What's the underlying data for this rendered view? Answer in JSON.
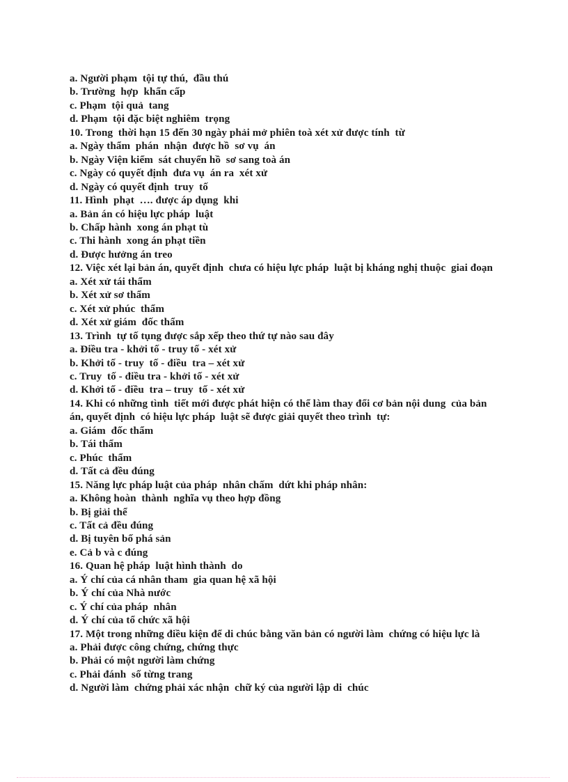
{
  "document": {
    "language": "vi",
    "page_background": "#ffffff",
    "text_color": "#1a1a1a",
    "footer_rule_color": "#f4a9cd",
    "lines": [
      {
        "id": "q9-opt-a",
        "kind": "option",
        "text": "a. Người phạm  tội tự thú,  đầu thú"
      },
      {
        "id": "q9-opt-b",
        "kind": "option",
        "text": "b. Trường  hợp  khẩn cấp"
      },
      {
        "id": "q9-opt-c",
        "kind": "option",
        "text": "c. Phạm  tội quả  tang"
      },
      {
        "id": "q9-opt-d",
        "kind": "option",
        "text": "d. Phạm  tội đặc biệt nghiêm  trọng"
      },
      {
        "id": "q10-stem",
        "kind": "question",
        "text": "10. Trong  thời hạn 15 đến 30 ngày phải mở phiên toà xét xử được tính  từ"
      },
      {
        "id": "q10-opt-a",
        "kind": "option",
        "text": "a. Ngày thẩm  phán  nhận  được hồ  sơ vụ  án"
      },
      {
        "id": "q10-opt-b",
        "kind": "option",
        "text": "b. Ngày Viện kiểm  sát chuyển hồ  sơ sang toà án"
      },
      {
        "id": "q10-opt-c",
        "kind": "option",
        "text": "c. Ngày có quyết định  đưa vụ  án ra  xét xử"
      },
      {
        "id": "q10-opt-d",
        "kind": "option",
        "text": "d. Ngày có quyết định  truy  tố"
      },
      {
        "id": "q11-stem",
        "kind": "question",
        "text": "11. Hình  phạt  …. được áp dụng  khi"
      },
      {
        "id": "q11-opt-a",
        "kind": "option",
        "text": "a. Bản án có hiệu lực pháp  luật"
      },
      {
        "id": "q11-opt-b",
        "kind": "option",
        "text": "b. Chấp hành  xong án phạt tù"
      },
      {
        "id": "q11-opt-c",
        "kind": "option",
        "text": "c. Thi hành  xong án phạt tiền"
      },
      {
        "id": "q11-opt-d",
        "kind": "option",
        "text": "d. Được hưởng án treo"
      },
      {
        "id": "q12-stem",
        "kind": "question",
        "text": "12. Việc xét lại bản án, quyết định  chưa có hiệu lực pháp  luật bị kháng nghị thuộc  giai đoạn"
      },
      {
        "id": "q12-opt-a",
        "kind": "option",
        "text": "a. Xét xử tái thẩm"
      },
      {
        "id": "q12-opt-b",
        "kind": "option",
        "text": "b. Xét xử sơ thẩm"
      },
      {
        "id": "q12-opt-c",
        "kind": "option",
        "text": "c. Xét xử phúc  thẩm"
      },
      {
        "id": "q12-opt-d",
        "kind": "option",
        "text": "d. Xét xử giám  đốc thẩm"
      },
      {
        "id": "q13-stem",
        "kind": "question",
        "text": "13. Trình  tự tố tụng được sắp xếp theo thứ tự nào sau đây"
      },
      {
        "id": "q13-opt-a",
        "kind": "option",
        "text": "a. Điều tra - khởi tố - truy tố - xét xử"
      },
      {
        "id": "q13-opt-b",
        "kind": "option",
        "text": "b. Khởi tố - truy  tố - điều  tra – xét xử"
      },
      {
        "id": "q13-opt-c",
        "kind": "option",
        "text": "c. Truy  tố - điều tra - khởi tố - xét xử"
      },
      {
        "id": "q13-opt-d",
        "kind": "option",
        "text": "d. Khởi tố - điều  tra – truy  tố - xét xử"
      },
      {
        "id": "q14-stem",
        "kind": "question",
        "text": "14. Khi có những tình  tiết mới được phát hiện có thể làm thay đổi cơ bản nội dung  của bản"
      },
      {
        "id": "q14-stem2",
        "kind": "cont",
        "text": "án, quyết định  có hiệu lực pháp  luật sẽ được giải quyết theo trình  tự:"
      },
      {
        "id": "q14-opt-a",
        "kind": "option",
        "text": "a. Giám  đốc thẩm"
      },
      {
        "id": "q14-opt-b",
        "kind": "option",
        "text": "b. Tái thẩm"
      },
      {
        "id": "q14-opt-c",
        "kind": "option",
        "text": "c. Phúc  thẩm"
      },
      {
        "id": "q14-opt-d",
        "kind": "option",
        "text": "d. Tất cả đều đúng"
      },
      {
        "id": "q15-stem",
        "kind": "question",
        "text": "15. Năng lực pháp luật của pháp  nhân chấm  dứt khi pháp nhân:"
      },
      {
        "id": "q15-opt-a",
        "kind": "option",
        "text": "a. Không hoàn  thành  nghĩa vụ theo hợp đồng"
      },
      {
        "id": "q15-opt-b",
        "kind": "option",
        "text": "b. Bị giải thể"
      },
      {
        "id": "q15-opt-c",
        "kind": "option",
        "text": "c. Tất cả đều đúng"
      },
      {
        "id": "q15-opt-d",
        "kind": "option",
        "text": "d. Bị tuyên bố phá sản"
      },
      {
        "id": "q15-opt-e",
        "kind": "option",
        "text": "e. Cả b và c đúng"
      },
      {
        "id": "q16-stem",
        "kind": "question",
        "text": "16. Quan hệ pháp  luật hình thành  do"
      },
      {
        "id": "q16-opt-a",
        "kind": "option",
        "text": "a. Ý chí của cá nhân tham  gia quan hệ xã hội"
      },
      {
        "id": "q16-opt-b",
        "kind": "option",
        "text": "b. Ý chí của Nhà nước"
      },
      {
        "id": "q16-opt-c",
        "kind": "option",
        "text": "c. Ý chí của pháp  nhân"
      },
      {
        "id": "q16-opt-d",
        "kind": "option",
        "text": "d. Ý chí của tổ chức xã hội"
      },
      {
        "id": "q17-stem",
        "kind": "question",
        "text": "17. Một trong những điều kiện để di chúc bằng văn bản có người làm  chứng có hiệu lực là"
      },
      {
        "id": "q17-opt-a",
        "kind": "option",
        "text": "a. Phải được công chứng, chứng thực"
      },
      {
        "id": "q17-opt-b",
        "kind": "option",
        "text": "b. Phải có một người làm chứng"
      },
      {
        "id": "q17-opt-c",
        "kind": "option",
        "text": "c. Phải đánh  số từng trang"
      },
      {
        "id": "q17-opt-d",
        "kind": "option",
        "text": "d. Người làm  chứng phải xác nhận  chữ ký của người lập di  chúc"
      }
    ]
  }
}
